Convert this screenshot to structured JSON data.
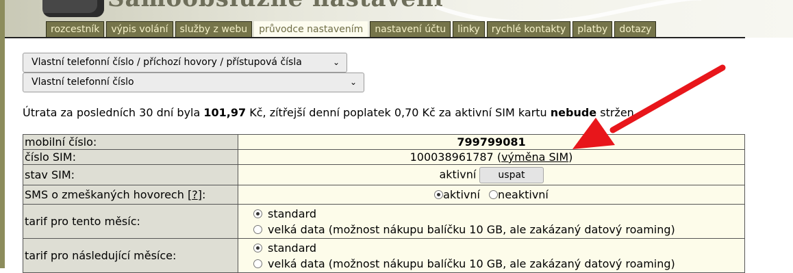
{
  "header": {
    "banner_title": "Samoobslužné nastavení",
    "tabs": [
      {
        "label": "rozcestník"
      },
      {
        "label": "výpis volání"
      },
      {
        "label": "služby z webu"
      },
      {
        "label": "průvodce nastavením"
      },
      {
        "label": "nastavení účtu"
      },
      {
        "label": "linky"
      },
      {
        "label": "rychlé kontakty"
      },
      {
        "label": "platby"
      },
      {
        "label": "dotazy"
      }
    ]
  },
  "selects": {
    "category": "Vlastní telefonní číslo / příchozí hovory / přístupová čísla",
    "item": "Vlastní telefonní číslo"
  },
  "spend": {
    "prefix": "Útrata za posledních 30 dní byla ",
    "amount": "101,97",
    "mid": " Kč, zítřejší denní poplatek 0,70 Kč za aktivní SIM kartu ",
    "status": "nebude",
    "suffix": " stržen."
  },
  "table": {
    "mobile_label": "mobilní číslo:",
    "mobile_value": "799799081",
    "sim_label": "číslo SIM:",
    "sim_value": "100038961787",
    "sim_link_open": "(",
    "sim_link": "výměna SIM",
    "sim_link_close": ")",
    "stav_label": "stav SIM:",
    "stav_value": "aktivní",
    "stav_button": "uspat",
    "sms_label": "SMS o zmeškaných hovorech",
    "sms_help_open": "[",
    "sms_help": "?",
    "sms_help_close": "]:",
    "sms_on": "aktivní",
    "sms_off": "neaktivní",
    "tarif_now_label": "tarif pro tento měsíc:",
    "tarif_next_label": "tarif pro následující měsíce:",
    "tarif_standard": "standard",
    "tarif_bigdata": "velká data (možnost nákupu balíčku 10 GB, ale zakázaný datový roaming)"
  },
  "colors": {
    "tab_bg": "#75744a",
    "tab_text": "#f4f0c8",
    "label_cell": "#deded4",
    "value_cell": "#fdfcea",
    "annotation_arrow": "#e8161b"
  }
}
